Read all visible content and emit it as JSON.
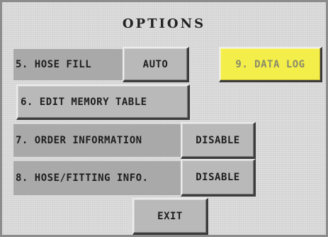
{
  "title": "OPTIONS",
  "rows": {
    "hose_fill": {
      "label": "5. HOSE FILL",
      "button": "AUTO"
    },
    "edit_memory_table": {
      "label": "6. EDIT MEMORY TABLE"
    },
    "order_information": {
      "label": "7. ORDER INFORMATION",
      "button": "DISABLE"
    },
    "hose_fitting_info": {
      "label": "8. HOSE/FITTING INFO.",
      "button": "DISABLE"
    }
  },
  "data_log": {
    "label": "9. DATA LOG"
  },
  "exit": {
    "label": "EXIT"
  },
  "colors": {
    "background": "#d9d9d9",
    "label_band": "#a9a9a9",
    "button_face": "#b9b9b9",
    "data_log_button": "#f3ee4a"
  }
}
